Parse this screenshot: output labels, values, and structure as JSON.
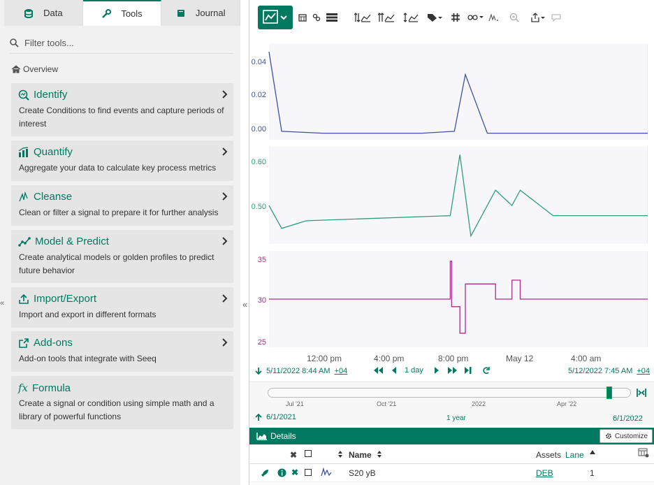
{
  "tabs": [
    {
      "label": "Data",
      "icon": "database-icon"
    },
    {
      "label": "Tools",
      "icon": "wrench-icon"
    },
    {
      "label": "Journal",
      "icon": "book-icon"
    }
  ],
  "filter_placeholder": "Filter tools...",
  "overview_label": "Overview",
  "tools": [
    {
      "title": "Identify",
      "desc": "Create Conditions to find events and capture periods of interest",
      "icon": "identify-icon"
    },
    {
      "title": "Quantify",
      "desc": "Aggregate your data to calculate key process metrics",
      "icon": "bar-chart-icon"
    },
    {
      "title": "Cleanse",
      "desc": "Clean or filter a signal to prepare it for further analysis",
      "icon": "cleanse-icon"
    },
    {
      "title": "Model & Predict",
      "desc": "Create analytical models or golden profiles to predict future behavior",
      "icon": "model-icon"
    },
    {
      "title": "Import/Export",
      "desc": "Import and export in different formats",
      "icon": "upload-icon"
    },
    {
      "title": "Add-ons",
      "desc": "Add-on tools that integrate with Seeq",
      "icon": "external-link-icon"
    },
    {
      "title": "Formula",
      "desc": "Create a signal or condition using simple math and a library of powerful functions",
      "icon": "fx-icon"
    }
  ],
  "chart": {
    "lane1_ticks": [
      "0.04",
      "0.02",
      "0.00"
    ],
    "lane2_ticks": [
      "0.60",
      "0.50"
    ],
    "lane3_ticks": [
      "35",
      "30",
      "25"
    ],
    "x_ticks": [
      "12:00 pm",
      "4:00 pm",
      "8:00 pm",
      "May 12",
      "4:00 am"
    ],
    "start_time": "5/11/2022 8:44 AM",
    "end_time": "5/12/2022 7:45 AM",
    "offset": "+04",
    "period": "1 day",
    "colors": {
      "series1": "#3f51a0",
      "series2": "#2e9b7f",
      "series3": "#a62d8d"
    }
  },
  "chart_data": [
    {
      "type": "line",
      "title": "",
      "series": [
        {
          "name": "",
          "x": [
            "5/11 8:44",
            "5/11 9:30",
            "5/11 12:00",
            "5/11 6:00 pm",
            "5/11 8:00 pm",
            "5/11 8:40 pm",
            "5/11 10:00 pm",
            "5/12 7:45"
          ],
          "values": [
            0.045,
            0.003,
            0.002,
            0.002,
            0.003,
            0.033,
            0.002,
            0.002
          ]
        }
      ],
      "ylim": [
        0,
        0.048
      ]
    },
    {
      "type": "line",
      "title": "",
      "series": [
        {
          "name": "",
          "x": [
            "5/11 8:44",
            "5/11 9:30",
            "5/11 11:00",
            "5/11 7:45 pm",
            "5/11 8:20 pm",
            "5/11 9:00 pm",
            "5/11 10:30 pm",
            "5/11 11:30 pm",
            "5/12 12:00 am",
            "5/12 2:00 am",
            "5/12 7:45"
          ],
          "values": [
            0.52,
            0.475,
            0.49,
            0.5,
            0.62,
            0.46,
            0.55,
            0.52,
            0.55,
            0.5,
            0.5
          ]
        }
      ],
      "ylim": [
        0.45,
        0.63
      ]
    },
    {
      "type": "line",
      "title": "",
      "series": [
        {
          "name": "",
          "x": [
            "5/11 8:44",
            "5/11 7:45 pm",
            "5/11 7:50 pm",
            "5/11 8:20 pm",
            "5/11 8:40 pm",
            "5/11 9:10 pm",
            "5/11 10:30 pm",
            "5/11 11:30 pm",
            "5/12 12:00 am",
            "5/12 7:45"
          ],
          "values": [
            30,
            35,
            29,
            25.5,
            32,
            32,
            30,
            32.5,
            30,
            30
          ]
        }
      ],
      "ylim": [
        24,
        36
      ]
    }
  ],
  "range": {
    "start": "6/1/2021",
    "end": "6/1/2022",
    "span": "1 year",
    "ticks": [
      "Jul '21",
      "Oct '21",
      "2022",
      "Apr '22"
    ]
  },
  "details": {
    "title": "Details",
    "customize": "Customize",
    "columns": {
      "name": "Name",
      "assets": "Assets",
      "lane": "Lane"
    },
    "row": {
      "name": "S20 yB",
      "asset": "DEB",
      "lane": "1"
    }
  }
}
